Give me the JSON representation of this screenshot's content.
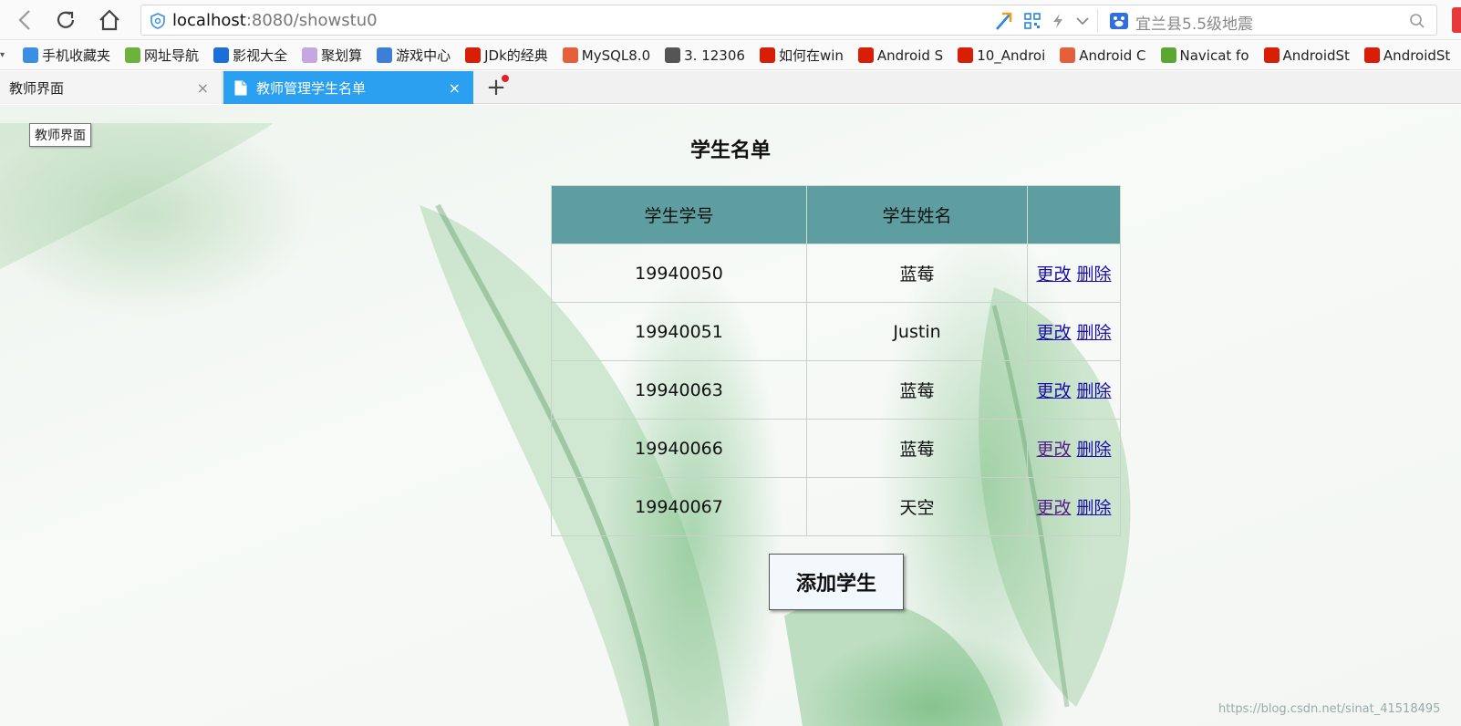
{
  "browser": {
    "url_host": "localhost",
    "url_path": ":8080/showstu0",
    "search_hint": "宜兰县5.5级地震",
    "bookmarks": [
      {
        "label": "手机收藏夹",
        "color": "#3a8ee6"
      },
      {
        "label": "网址导航",
        "color": "#6cb33e"
      },
      {
        "label": "影视大全",
        "color": "#1d6fd8"
      },
      {
        "label": "聚划算",
        "color": "#c5a8e0"
      },
      {
        "label": "游戏中心",
        "color": "#3c7ed8"
      },
      {
        "label": "JDk的经典",
        "color": "#d81e06"
      },
      {
        "label": "MySQL8.0",
        "color": "#e5603a"
      },
      {
        "label": "3. 12306",
        "color": "#555555"
      },
      {
        "label": "如何在win",
        "color": "#d81e06"
      },
      {
        "label": "Android S",
        "color": "#d81e06"
      },
      {
        "label": "10_Androi",
        "color": "#d81e06"
      },
      {
        "label": "Android C",
        "color": "#e5603a"
      },
      {
        "label": "Navicat fo",
        "color": "#5aa832"
      },
      {
        "label": "AndroidSt",
        "color": "#d81e06"
      },
      {
        "label": "AndroidSt",
        "color": "#d81e06"
      }
    ],
    "tabs": [
      {
        "title": "教师界面"
      },
      {
        "title": "教师管理学生名单"
      }
    ],
    "close_symbol": "×",
    "new_tab_symbol": "+"
  },
  "page": {
    "tooltip": "教师界面",
    "title": "学生名单",
    "columns": [
      "学生学号",
      "学生姓名",
      ""
    ],
    "rows": [
      {
        "id": "19940050",
        "name": "蓝莓",
        "edit": "更改",
        "delete": "删除"
      },
      {
        "id": "19940051",
        "name": "Justin",
        "edit": "更改",
        "delete": "删除"
      },
      {
        "id": "19940063",
        "name": "蓝莓",
        "edit": "更改",
        "delete": "删除"
      },
      {
        "id": "19940066",
        "name": "蓝莓",
        "edit": "更改",
        "delete": "删除"
      },
      {
        "id": "19940067",
        "name": "天空",
        "edit": "更改",
        "delete": "删除"
      }
    ],
    "add_button": "添加学生",
    "watermark": "https://blog.csdn.net/sinat_41518495"
  },
  "colors": {
    "header_bg": "#5f9ea0",
    "active_tab": "#2ba0f0",
    "link": "#1a0dab",
    "visited_link": "#551a8b"
  }
}
